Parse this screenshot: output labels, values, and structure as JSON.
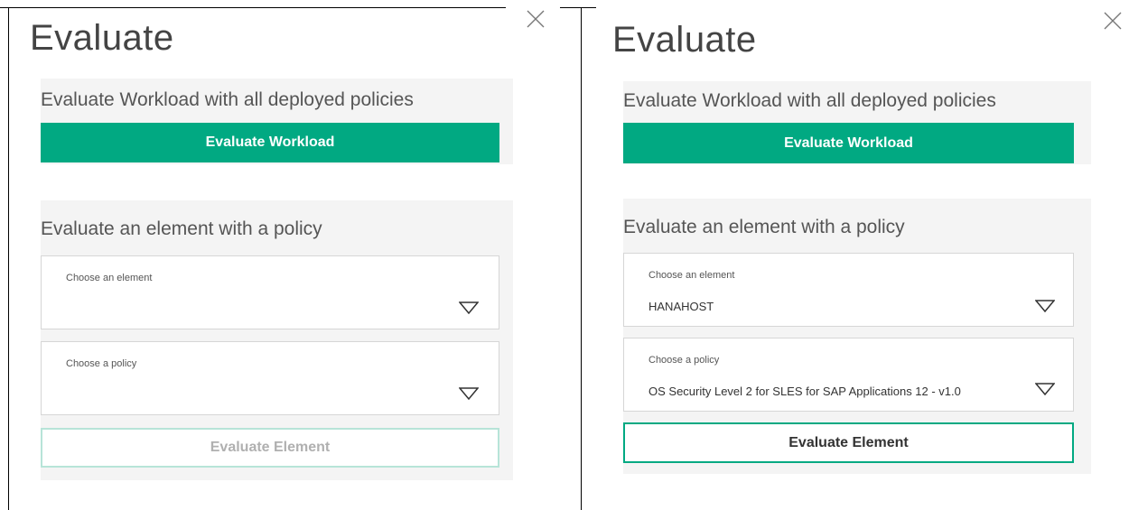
{
  "left_panel": {
    "title": "Evaluate",
    "workload_section": {
      "heading": "Evaluate Workload with all deployed policies",
      "button_label": "Evaluate Workload"
    },
    "element_section": {
      "heading": "Evaluate an element with a policy",
      "element_select": {
        "label": "Choose an element",
        "value": ""
      },
      "policy_select": {
        "label": "Choose a policy",
        "value": ""
      },
      "button_label": "Evaluate Element",
      "button_state": "disabled"
    }
  },
  "right_panel": {
    "title": "Evaluate",
    "workload_section": {
      "heading": "Evaluate Workload with all deployed policies",
      "button_label": "Evaluate Workload"
    },
    "element_section": {
      "heading": "Evaluate an element with a policy",
      "element_select": {
        "label": "Choose an element",
        "value": "HANAHOST"
      },
      "policy_select": {
        "label": "Choose a policy",
        "value": "OS Security Level 2 for SLES for SAP Applications 12 - v1.0"
      },
      "button_label": "Evaluate Element",
      "button_state": "enabled"
    }
  },
  "colors": {
    "accent": "#01a982",
    "disabled_border": "#b7e4d8",
    "section_background": "#f4f4f4"
  },
  "icons": [
    "close-icon",
    "chevron-down-icon"
  ]
}
